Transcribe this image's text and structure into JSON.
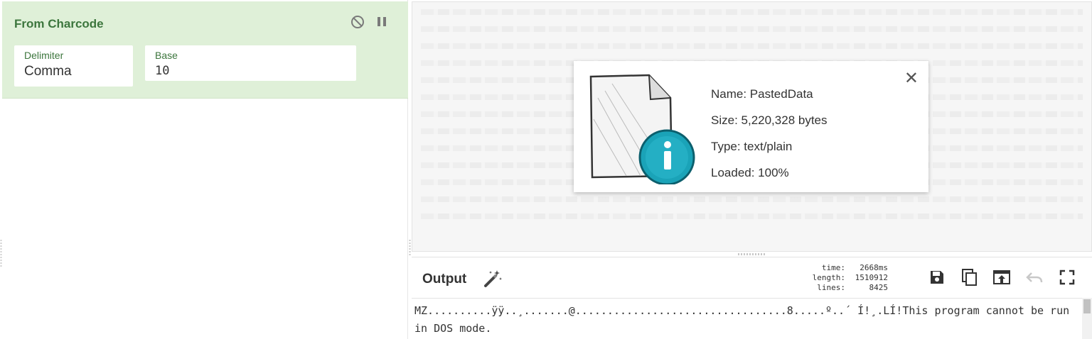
{
  "recipe": {
    "operation": {
      "title": "From Charcode",
      "disable_icon": "disable-icon",
      "pause_icon": "pause-icon",
      "fields": [
        {
          "label": "Delimiter",
          "value": "Comma"
        },
        {
          "label": "Base",
          "value": "10"
        }
      ]
    }
  },
  "input": {
    "file": {
      "name": "Name: PastedData",
      "size": "Size: 5,220,328 bytes",
      "type": "Type: text/plain",
      "loaded": "Loaded: 100%",
      "close": "✕",
      "icon": "file-info-icon"
    }
  },
  "output": {
    "title": "Output",
    "magic_icon": "magic-wand-icon",
    "stats": {
      "time_label": "time:",
      "time_value": "2668ms",
      "length_label": "length:",
      "length_value": "1510912",
      "lines_label": "lines:",
      "lines_value": "8425"
    },
    "buttons": [
      "save-icon",
      "copy-icon",
      "replace-input-icon",
      "undo-icon",
      "maximise-icon"
    ],
    "text": "MZ..........ÿÿ..¸.......@.................................8.....º..´ Í!¸.LÍ!This program cannot be run in DOS mode."
  },
  "colors": {
    "operation_bg": "#dff0d8",
    "operation_title": "#3c763d",
    "accent_info": "#1aa3b8"
  }
}
